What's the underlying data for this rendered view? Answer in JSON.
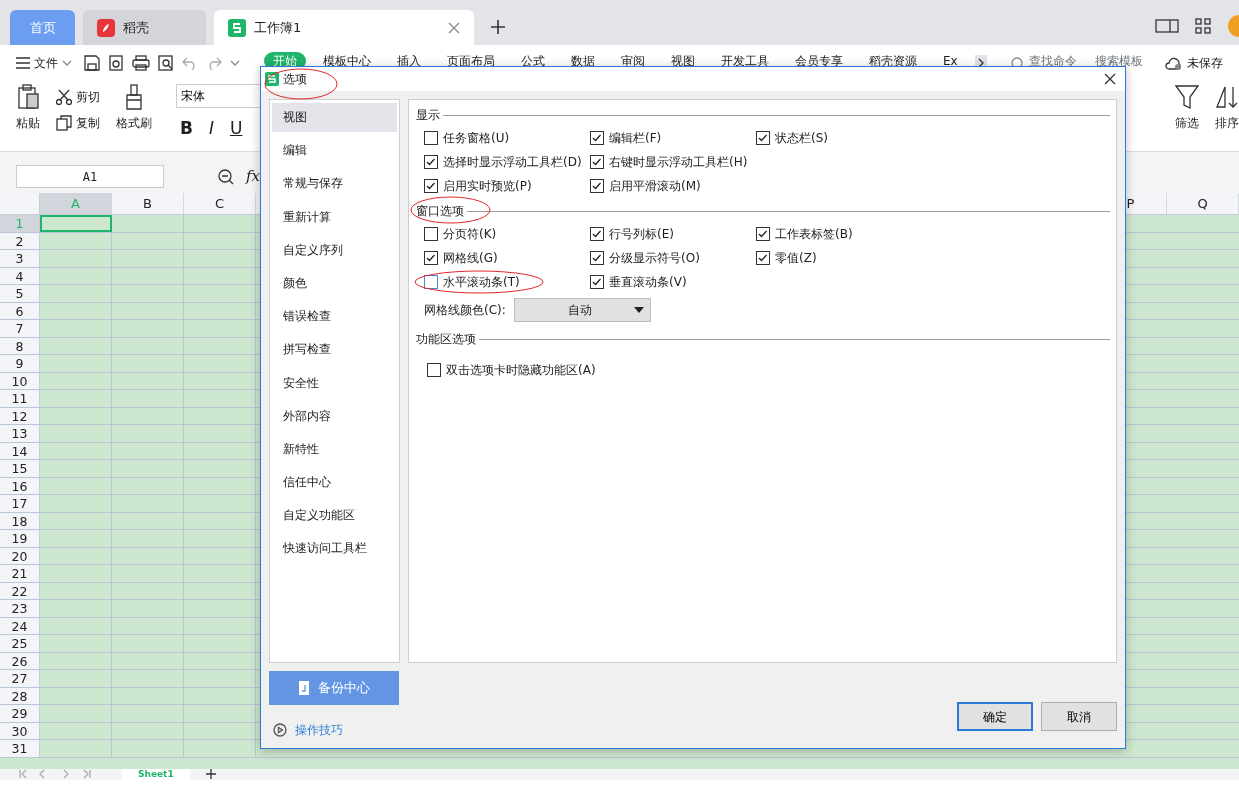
{
  "app_tabs": [
    {
      "label": "首页",
      "kind": "home",
      "selected": false
    },
    {
      "label": "稻壳",
      "kind": "docer",
      "selected": false
    },
    {
      "label": "工作簿1",
      "kind": "sheet",
      "selected": true
    }
  ],
  "file_menu": "文件",
  "ribbon_tabs": [
    {
      "label": "开始",
      "selected": true
    },
    {
      "label": "模板中心",
      "selected": false
    },
    {
      "label": "插入",
      "selected": false
    },
    {
      "label": "页面布局",
      "selected": false
    },
    {
      "label": "公式",
      "selected": false
    },
    {
      "label": "数据",
      "selected": false
    },
    {
      "label": "审阅",
      "selected": false
    },
    {
      "label": "视图",
      "selected": false
    },
    {
      "label": "开发工具",
      "selected": false
    },
    {
      "label": "会员专享",
      "selected": false
    },
    {
      "label": "稻壳资源",
      "selected": false
    },
    {
      "label": "Ex",
      "selected": false
    }
  ],
  "search": {
    "placeholder": "查找命令",
    "template_link": "搜索模板"
  },
  "save_status": "未保存",
  "ribbon": {
    "paste": "粘贴",
    "cut": "剪切",
    "copy": "复制",
    "format_painter": "格式刷",
    "font": "宋体",
    "font_styles": [
      "B",
      "I",
      "U"
    ],
    "filter": "筛选",
    "sort": "排序"
  },
  "name_box": "A1",
  "formula_label": "fx",
  "grid": {
    "columns_left": [
      {
        "label": "A",
        "selected": true
      },
      {
        "label": "B",
        "selected": false
      },
      {
        "label": "C",
        "selected": false
      }
    ],
    "columns_right": [
      {
        "label": "P",
        "selected": false
      },
      {
        "label": "Q",
        "selected": false
      }
    ],
    "rows": [
      {
        "label": "1",
        "selected": true
      },
      {
        "label": "2",
        "selected": false
      },
      {
        "label": "3",
        "selected": false
      },
      {
        "label": "4",
        "selected": false
      },
      {
        "label": "5",
        "selected": false
      },
      {
        "label": "6",
        "selected": false
      },
      {
        "label": "7",
        "selected": false
      },
      {
        "label": "8",
        "selected": false
      },
      {
        "label": "9",
        "selected": false
      },
      {
        "label": "10",
        "selected": false
      },
      {
        "label": "11",
        "selected": false
      },
      {
        "label": "12",
        "selected": false
      },
      {
        "label": "13",
        "selected": false
      },
      {
        "label": "14",
        "selected": false
      },
      {
        "label": "15",
        "selected": false
      },
      {
        "label": "16",
        "selected": false
      },
      {
        "label": "17",
        "selected": false
      },
      {
        "label": "18",
        "selected": false
      },
      {
        "label": "19",
        "selected": false
      },
      {
        "label": "20",
        "selected": false
      },
      {
        "label": "21",
        "selected": false
      },
      {
        "label": "22",
        "selected": false
      },
      {
        "label": "23",
        "selected": false
      },
      {
        "label": "24",
        "selected": false
      },
      {
        "label": "25",
        "selected": false
      },
      {
        "label": "26",
        "selected": false
      },
      {
        "label": "27",
        "selected": false
      },
      {
        "label": "28",
        "selected": false
      },
      {
        "label": "29",
        "selected": false
      },
      {
        "label": "30",
        "selected": false
      },
      {
        "label": "31",
        "selected": false
      }
    ]
  },
  "sheet_tabs": [
    {
      "label": "Sheet1",
      "selected": true
    }
  ],
  "dialog": {
    "title": "选项",
    "annotated": true,
    "nav": [
      {
        "label": "视图",
        "selected": true
      },
      {
        "label": "编辑",
        "selected": false
      },
      {
        "label": "常规与保存",
        "selected": false
      },
      {
        "label": "重新计算",
        "selected": false
      },
      {
        "label": "自定义序列",
        "selected": false
      },
      {
        "label": "颜色",
        "selected": false
      },
      {
        "label": "错误检查",
        "selected": false
      },
      {
        "label": "拼写检查",
        "selected": false
      },
      {
        "label": "安全性",
        "selected": false
      },
      {
        "label": "外部内容",
        "selected": false
      },
      {
        "label": "新特性",
        "selected": false
      },
      {
        "label": "信任中心",
        "selected": false
      },
      {
        "label": "自定义功能区",
        "selected": false
      },
      {
        "label": "快速访问工具栏",
        "selected": false
      }
    ],
    "sections": [
      {
        "title": "显示",
        "annotated": false,
        "rows": [
          [
            {
              "label": "任务窗格(U)",
              "checked": false,
              "focused": false,
              "annotated": false
            },
            {
              "label": "编辑栏(F)",
              "checked": true,
              "focused": false,
              "annotated": false
            },
            {
              "label": "状态栏(S)",
              "checked": true,
              "focused": false,
              "annotated": false
            }
          ],
          [
            {
              "label": "选择时显示浮动工具栏(D)",
              "checked": true,
              "focused": false,
              "annotated": false
            },
            {
              "label": "右键时显示浮动工具栏(H)",
              "checked": true,
              "focused": false,
              "annotated": false
            }
          ],
          [
            {
              "label": "启用实时预览(P)",
              "checked": true,
              "focused": false,
              "annotated": false
            },
            {
              "label": "启用平滑滚动(M)",
              "checked": true,
              "focused": false,
              "annotated": false
            }
          ]
        ]
      },
      {
        "title": "窗口选项",
        "annotated": true,
        "rows": [
          [
            {
              "label": "分页符(K)",
              "checked": false,
              "focused": false,
              "annotated": false
            },
            {
              "label": "行号列标(E)",
              "checked": true,
              "focused": false,
              "annotated": false
            },
            {
              "label": "工作表标签(B)",
              "checked": true,
              "focused": false,
              "annotated": false
            }
          ],
          [
            {
              "label": "网格线(G)",
              "checked": true,
              "focused": false,
              "annotated": false
            },
            {
              "label": "分级显示符号(O)",
              "checked": true,
              "focused": false,
              "annotated": false
            },
            {
              "label": "零值(Z)",
              "checked": true,
              "focused": false,
              "annotated": false
            }
          ],
          [
            {
              "label": "水平滚动条(T)",
              "checked": false,
              "focused": true,
              "annotated": true
            },
            {
              "label": "垂直滚动条(V)",
              "checked": true,
              "focused": false,
              "annotated": false
            }
          ]
        ],
        "select": {
          "label": "网格线颜色(C):",
          "value": "自动"
        }
      },
      {
        "title": "功能区选项",
        "annotated": false,
        "rows": [
          [
            {
              "label": "双击选项卡时隐藏功能区(A)",
              "checked": false,
              "focused": false,
              "annotated": false
            }
          ]
        ]
      }
    ],
    "backup_button": "备份中心",
    "tips_link": "操作技巧",
    "buttons": [
      {
        "label": "确定",
        "default": true
      },
      {
        "label": "取消",
        "default": false
      }
    ]
  }
}
